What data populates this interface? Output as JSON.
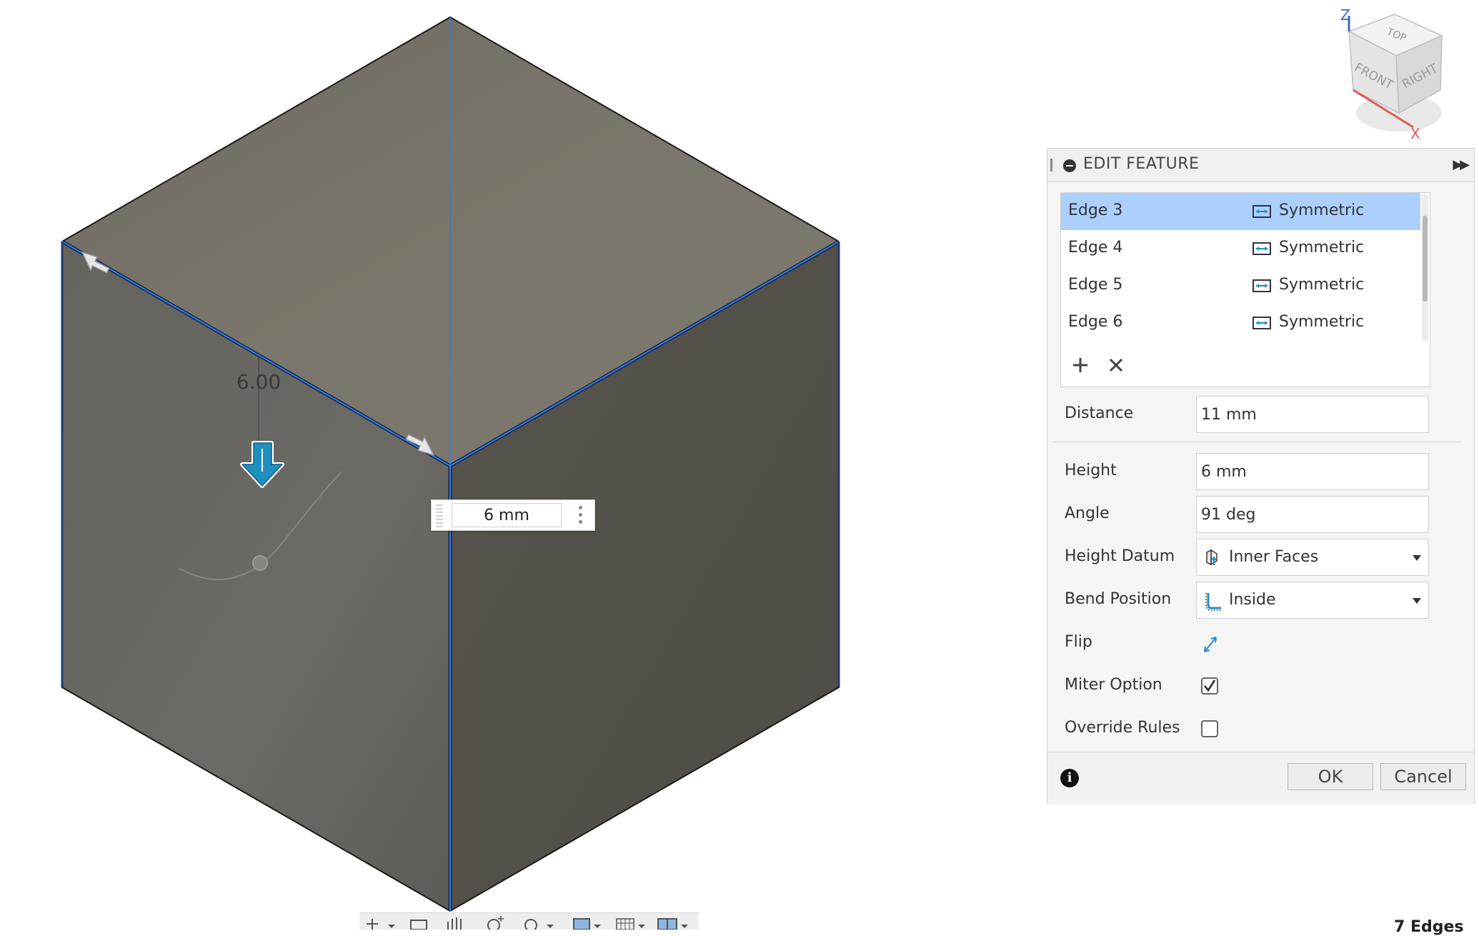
{
  "viewcube": {
    "top": "TOP",
    "front": "FRONT",
    "right": "RIGHT",
    "axis_x": "X",
    "axis_z": "Z"
  },
  "viewport": {
    "dimension_label": "6.00",
    "dimension_input_value": "6 mm"
  },
  "panel": {
    "title": "EDIT FEATURE",
    "edges": [
      {
        "name": "Edge 3",
        "type": "Symmetric",
        "selected": true
      },
      {
        "name": "Edge 4",
        "type": "Symmetric",
        "selected": false
      },
      {
        "name": "Edge 5",
        "type": "Symmetric",
        "selected": false
      },
      {
        "name": "Edge 6",
        "type": "Symmetric",
        "selected": false
      }
    ],
    "distance": {
      "label": "Distance",
      "value": "11 mm"
    },
    "height": {
      "label": "Height",
      "value": "6 mm"
    },
    "angle": {
      "label": "Angle",
      "value": "91 deg"
    },
    "height_datum": {
      "label": "Height Datum",
      "value": "Inner Faces"
    },
    "bend_position": {
      "label": "Bend Position",
      "value": "Inside"
    },
    "flip": {
      "label": "Flip"
    },
    "miter_option": {
      "label": "Miter Option",
      "checked": true
    },
    "override_rules": {
      "label": "Override Rules",
      "checked": false
    },
    "ok_label": "OK",
    "cancel_label": "Cancel"
  },
  "status": {
    "text": "7 Edges"
  },
  "colors": {
    "accent_blue": "#1e8fc6",
    "selection": "#abd0ff",
    "face_top": "#76736b",
    "face_left": "#66655f",
    "face_right": "#55524b"
  }
}
